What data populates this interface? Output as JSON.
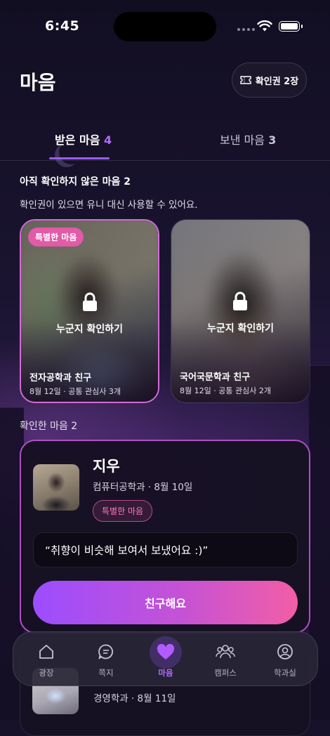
{
  "status_bar": {
    "time": "6:45"
  },
  "header": {
    "title": "마음",
    "ticket_label": "확인권 2장"
  },
  "tabs": [
    {
      "label": "받은 마음",
      "count": "4",
      "active": true
    },
    {
      "label": "보낸 마음",
      "count": "3",
      "active": false
    }
  ],
  "unconfirmed": {
    "heading": "아직 확인하지 않은 마음 2",
    "subtext": "확인권이 있으면 유니 대신 사용할 수 있어요.",
    "cards": [
      {
        "badge": "특별한 마음",
        "reveal_label": "누군지 확인하기",
        "major": "전자공학과 친구",
        "meta": "8월 12일 · 공통 관심사 3개"
      },
      {
        "badge": "",
        "reveal_label": "누군지 확인하기",
        "major": "국어국문학과 친구",
        "meta": "8월 12일 · 공통 관심사 2개"
      }
    ]
  },
  "confirmed": {
    "heading": "확인한 마음 2",
    "profiles": [
      {
        "name": "지우",
        "meta": "컴퓨터공학과 · 8월 10일",
        "badge": "특별한 마음",
        "message": "“취향이 비슷해 보여서 보냈어요 :)”",
        "action_label": "친구해요"
      },
      {
        "meta": "경영학과 · 8월 11일"
      }
    ]
  },
  "bottom_nav": [
    {
      "label": "광장",
      "icon": "home-icon"
    },
    {
      "label": "쪽지",
      "icon": "message-icon"
    },
    {
      "label": "마음",
      "icon": "heart-icon",
      "active": true
    },
    {
      "label": "캠퍼스",
      "icon": "people-icon"
    },
    {
      "label": "학과실",
      "icon": "profile-icon"
    }
  ],
  "colors": {
    "accent": "#9b5cff",
    "pink": "#e25aa8",
    "background": "#17122a"
  }
}
